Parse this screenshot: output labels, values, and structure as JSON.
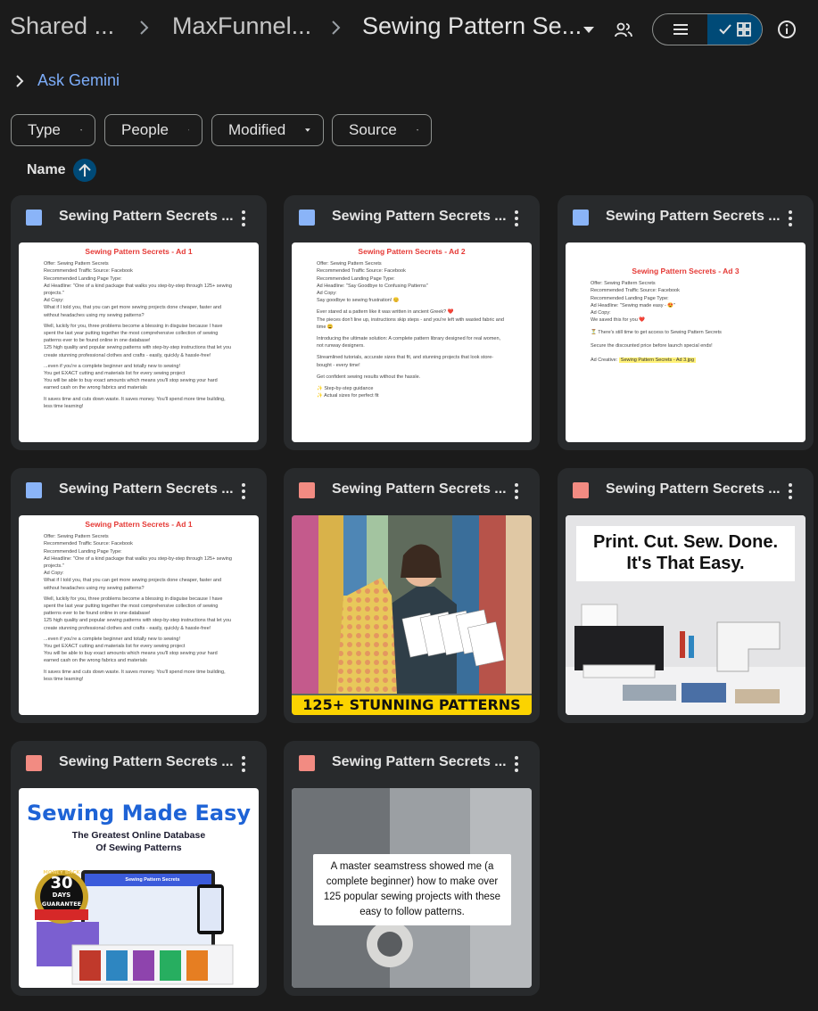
{
  "breadcrumb": {
    "items": [
      "Shared ...",
      "MaxFunnel...",
      "Sewing Pattern Se..."
    ]
  },
  "gemini": {
    "label": "Ask Gemini"
  },
  "filters": [
    "Type",
    "People",
    "Modified",
    "Source"
  ],
  "sort": {
    "label": "Name",
    "direction": "ascending"
  },
  "colors": {
    "accent": "#004a77",
    "link": "#7cacf8",
    "doc": "#8ab4f8",
    "image": "#f28b82"
  },
  "files": [
    {
      "title": "Sewing Pattern Secrets ...",
      "kind": "doc",
      "icon": "google-docs-icon",
      "doc": {
        "heading": "Sewing Pattern Secrets - Ad 1",
        "lines": [
          "Offer: Sewing Pattern Secrets",
          "Recommended Traffic Source: Facebook",
          "Recommended Landing Page Type:",
          "Ad Headline: \"One of a kind package that walks you step-by-step through 125+ sewing projects.\"",
          "Ad Copy:",
          "What if I told you, that you can get more sewing projects done cheaper, faster and without headaches using my sewing patterns?",
          "Well, luckily for you, three problems become a blessing in disguise because I have spent the last year putting together the most comprehensive collection of sewing patterns ever to be found online in one database!",
          "125 high quality and popular sewing patterns with step-by-step instructions that let you create stunning professional clothes and crafts - easily, quickly & hassle-free!",
          "...even if you're a complete beginner and totally new to sewing!",
          "You get EXACT cutting and materials list for every sewing project",
          "You will be able to buy exact amounts which means you'll stop sewing your hard earned cash on the wrong fabrics and materials",
          "It saves time and cuts down waste. It saves money. You'll spend more time building, less time learning!"
        ]
      }
    },
    {
      "title": "Sewing Pattern Secrets ...",
      "kind": "doc",
      "icon": "google-docs-icon",
      "doc": {
        "heading": "Sewing Pattern Secrets - Ad 2",
        "lines": [
          "Offer: Sewing Pattern Secrets",
          "Recommended Traffic Source: Facebook",
          "Recommended Landing Page Type:",
          "Ad Headline: \"Say Goodbye to Confusing Patterns\"",
          "Ad Copy:",
          "Say goodbye to sewing frustration! 😊",
          "Ever stared at a pattern like it was written in ancient Greek? ❤️",
          "The pieces don't line up, instructions skip steps - and you're left with wasted fabric and time 😩",
          "Introducing the ultimate solution: A complete pattern library designed for real women, not runway designers.",
          "Streamlined tutorials, accurate sizes that fit, and stunning projects that look store-bought - every time!",
          "Get confident sewing results without the hassle.",
          "✨ Step-by-step guidance",
          "✨ Actual sizes for perfect fit"
        ]
      }
    },
    {
      "title": "Sewing Pattern Secrets ...",
      "kind": "doc",
      "icon": "google-docs-icon",
      "doc": {
        "heading": "Sewing Pattern Secrets - Ad 3",
        "lines": [
          "Offer: Sewing Pattern Secrets",
          "Recommended Traffic Source: Facebook",
          "Recommended Landing Page Type:",
          "Ad Headline: \"Sewing made easy - 😍\"",
          "Ad Copy:",
          "We saved this for you ❤️",
          "⏳ There's still time to get access to Sewing Pattern Secrets",
          "Secure the discounted price before launch special ends!"
        ],
        "creative_label": "Ad Creative:",
        "creative_file": "Sewing Pattern Secrets - Ad 3.jpg"
      }
    },
    {
      "title": "Sewing Pattern Secrets ...",
      "kind": "doc",
      "icon": "google-docs-icon",
      "doc": {
        "heading": "Sewing Pattern Secrets - Ad 1",
        "lines": [
          "Offer: Sewing Pattern Secrets",
          "Recommended Traffic Source: Facebook",
          "Recommended Landing Page Type:",
          "Ad Headline: \"One of a kind package that walks you step-by-step through 125+ sewing projects.\"",
          "Ad Copy:",
          "What if I told you, that you can get more sewing projects done cheaper, faster and without headaches using my sewing patterns?",
          "Well, luckily for you, three problems become a blessing in disguise because I have spent the last year putting together the most comprehensive collection of sewing patterns ever to be found online in one database!",
          "125 high quality and popular sewing patterns with step-by-step instructions that let you create stunning professional clothes and crafts - easily, quickly & hassle-free!",
          "...even if you're a complete beginner and totally new to sewing!",
          "You get EXACT cutting and materials list for every sewing project",
          "You will be able to buy exact amounts which means you'll stop sewing your hard earned cash on the wrong fabrics and materials",
          "It saves time and cuts down waste. It saves money. You'll spend more time building, less time learning!"
        ]
      }
    },
    {
      "title": "Sewing Pattern Secrets ...",
      "kind": "image",
      "icon": "image-file-icon",
      "caption": "125+ STUNNING PATTERNS"
    },
    {
      "title": "Sewing Pattern Secrets ...",
      "kind": "image",
      "icon": "image-file-icon",
      "caption_line1": "Print. Cut. Sew. Done.",
      "caption_line2": "It's That Easy."
    },
    {
      "title": "Sewing Pattern Secrets ...",
      "kind": "image",
      "icon": "image-file-icon",
      "headline": "Sewing Made Easy",
      "subline1": "The Greatest Online Database",
      "subline2": "Of Sewing Patterns",
      "badge_top": "MONEY BACK",
      "badge_num": "30",
      "badge_unit": "DAYS",
      "badge_label": "GUARANTEE",
      "product_name": "Sewing Pattern Secrets"
    },
    {
      "title": "Sewing Pattern Secrets ...",
      "kind": "video",
      "icon": "video-file-icon",
      "caption": "A master seamstress showed me (a complete beginner) how to make over 125 popular sewing projects with these easy to follow patterns."
    }
  ]
}
